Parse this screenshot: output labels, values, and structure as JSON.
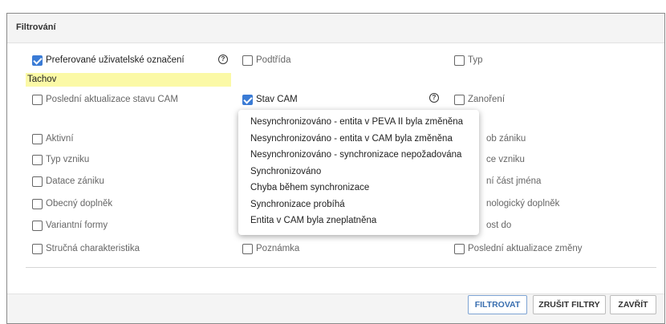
{
  "dialog": {
    "title": "Filtrování"
  },
  "fields": {
    "preferovane": {
      "label": "Preferované uživatelské označení",
      "checked": true,
      "value": "Tachov"
    },
    "podtrida": {
      "label": "Podtřída",
      "checked": false
    },
    "typ": {
      "label": "Typ",
      "checked": false
    },
    "posledni_aktualizace_cam": {
      "label": "Poslední aktualizace stavu CAM",
      "checked": false
    },
    "stav_cam": {
      "label": "Stav CAM",
      "checked": true
    },
    "zanoreni": {
      "label": "Zanoření",
      "checked": false
    },
    "aktivni": {
      "label": "Aktivní",
      "checked": false
    },
    "zpusob_zaniku": {
      "label": "ob zániku",
      "checked": false
    },
    "typ_vzniku": {
      "label": "Typ vzniku",
      "checked": false
    },
    "datace_vzniku": {
      "label": "ce vzniku",
      "checked": false
    },
    "datace_zaniku": {
      "label": "Datace zániku",
      "checked": false
    },
    "cast_jmena": {
      "label": "ní část jména",
      "checked": false
    },
    "obecny_doplnek": {
      "label": "Obecný doplněk",
      "checked": false
    },
    "chronologicky": {
      "label": "nologický doplněk",
      "checked": false
    },
    "variantni_formy": {
      "label": "Variantní formy",
      "checked": false
    },
    "platnost_do": {
      "label": "ost do",
      "checked": false
    },
    "strucna": {
      "label": "Stručná charakteristika",
      "checked": false
    },
    "poznamka": {
      "label": "Poznámka",
      "checked": false
    },
    "posledni_aktualizace_zmeny": {
      "label": "Poslední aktualizace změny",
      "checked": false
    }
  },
  "help_icon": "?",
  "dropdown": {
    "items": [
      "Nesynchronizováno - entita v PEVA II byla změněna",
      "Nesynchronizováno - entita v CAM byla změněna",
      "Nesynchronizováno - synchronizace nepožadována",
      "Synchronizováno",
      "Chyba během synchronizace",
      "Synchronizace probíhá",
      "Entita v CAM byla zneplatněna"
    ]
  },
  "footer": {
    "filter_label": "FILTROVAT",
    "clear_label": "ZRUŠIT FILTRY",
    "close_label": "ZAVŘÍT"
  },
  "colors": {
    "accent": "#3a7bd5",
    "highlight": "#fbf9a6",
    "header_bg": "#f4f4f4"
  }
}
